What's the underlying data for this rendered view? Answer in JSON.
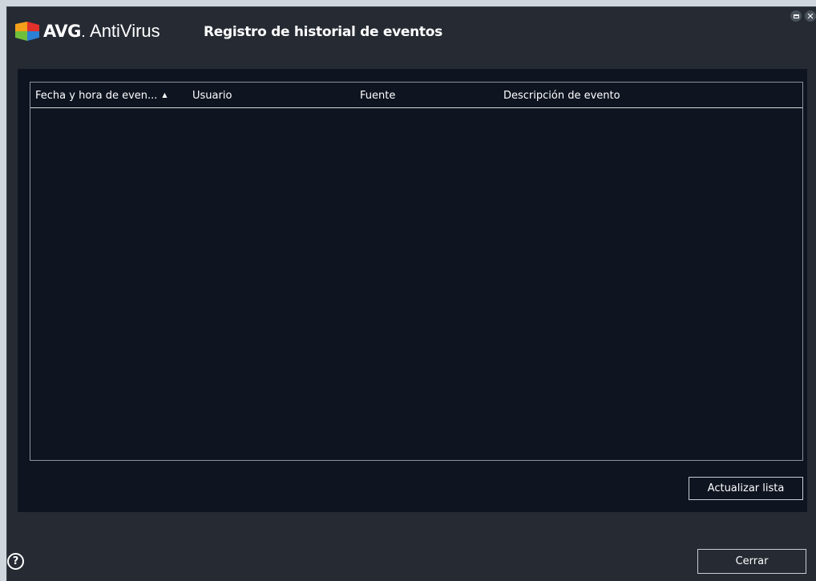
{
  "window": {
    "brand_name": "AVG",
    "brand_dot": ".",
    "product_name": "AntiVirus",
    "dialog_title": "Registro de historial de eventos"
  },
  "table": {
    "columns": [
      {
        "label": "Fecha y hora de even...",
        "sort": "ascending"
      },
      {
        "label": "Usuario"
      },
      {
        "label": "Fuente"
      },
      {
        "label": "Descripción de evento"
      }
    ],
    "sort_arrow": "▲",
    "rows": []
  },
  "buttons": {
    "refresh_label": "Actualizar lista",
    "close_label": "Cerrar",
    "help_glyph": "?"
  },
  "icons": {
    "logo": "avg-logo-icon",
    "maximize": "maximize-icon",
    "close": "close-icon",
    "help": "help-icon"
  },
  "colors": {
    "window_bg": "#252a33",
    "panel_bg": "#0e1420",
    "logo_orange": "#f5a01a",
    "logo_red": "#e2312b",
    "logo_green": "#6fbf3a",
    "logo_blue": "#2b7fd4"
  }
}
